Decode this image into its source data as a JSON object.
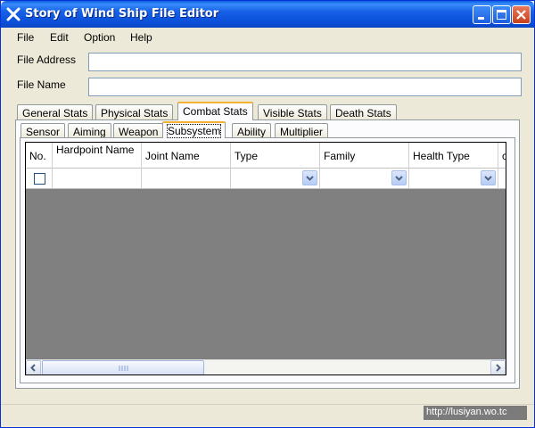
{
  "window": {
    "title": "Story of Wind Ship File Editor"
  },
  "menu": [
    "File",
    "Edit",
    "Option",
    "Help"
  ],
  "fields": {
    "file_address": {
      "label": "File Address",
      "value": ""
    },
    "file_name": {
      "label": "File Name",
      "value": ""
    }
  },
  "main_tabs": [
    "General Stats",
    "Physical Stats",
    "Combat Stats",
    "Visible Stats",
    "Death Stats"
  ],
  "active_main_tab": "Combat Stats",
  "sub_tabs": [
    "Sensor",
    "Aiming",
    "Weapon",
    "Subsystem",
    "Ability",
    "Multiplier"
  ],
  "active_sub_tab": "Subsystem",
  "grid": {
    "columns": [
      "No.",
      "Hardpoint Name",
      "Joint Name",
      "Type",
      "Family",
      "Health Type",
      "c"
    ]
  },
  "watermark": "http://lusiyan.wo.tc",
  "colors": {
    "title_bar": "#0b4fd8",
    "window_bg": "#ece9d8",
    "grid_bg": "#808080",
    "active_tab_accent": "#f5b134"
  }
}
